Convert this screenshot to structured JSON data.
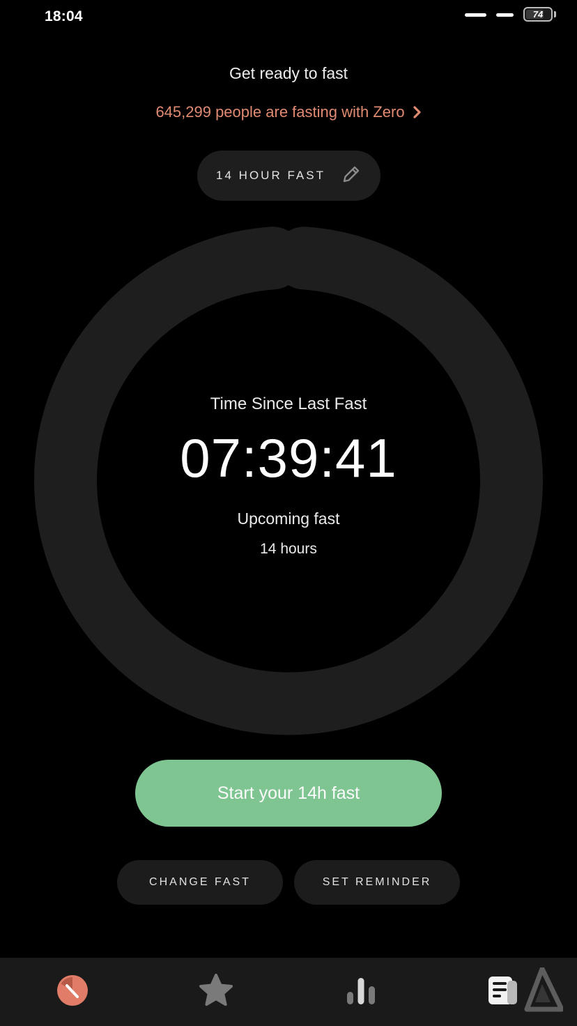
{
  "status_bar": {
    "time": "18:04",
    "battery_level": "74",
    "battery_fraction": 0.74
  },
  "header": {
    "title": "Get ready to fast",
    "community_text": "645,299 people are fasting with Zero"
  },
  "fast_selector": {
    "label": "14 HOUR FAST"
  },
  "timer_panel": {
    "label": "Time Since Last Fast",
    "elapsed": "07:39:41",
    "upcoming_label": "Upcoming fast",
    "upcoming_duration": "14 hours"
  },
  "actions": {
    "start_label": "Start your 14h fast",
    "change_label": "CHANGE FAST",
    "reminder_label": "SET REMINDER"
  },
  "tab_bar": {
    "items": [
      {
        "icon": "timer-icon",
        "active": true
      },
      {
        "icon": "star-icon",
        "active": false
      },
      {
        "icon": "stats-icon",
        "active": false
      },
      {
        "icon": "articles-icon",
        "active": false
      }
    ]
  },
  "colors": {
    "accent_coral": "#e08a72",
    "start_green": "#7fc592",
    "ring_track": "#1e1e1e",
    "background": "#000000"
  }
}
